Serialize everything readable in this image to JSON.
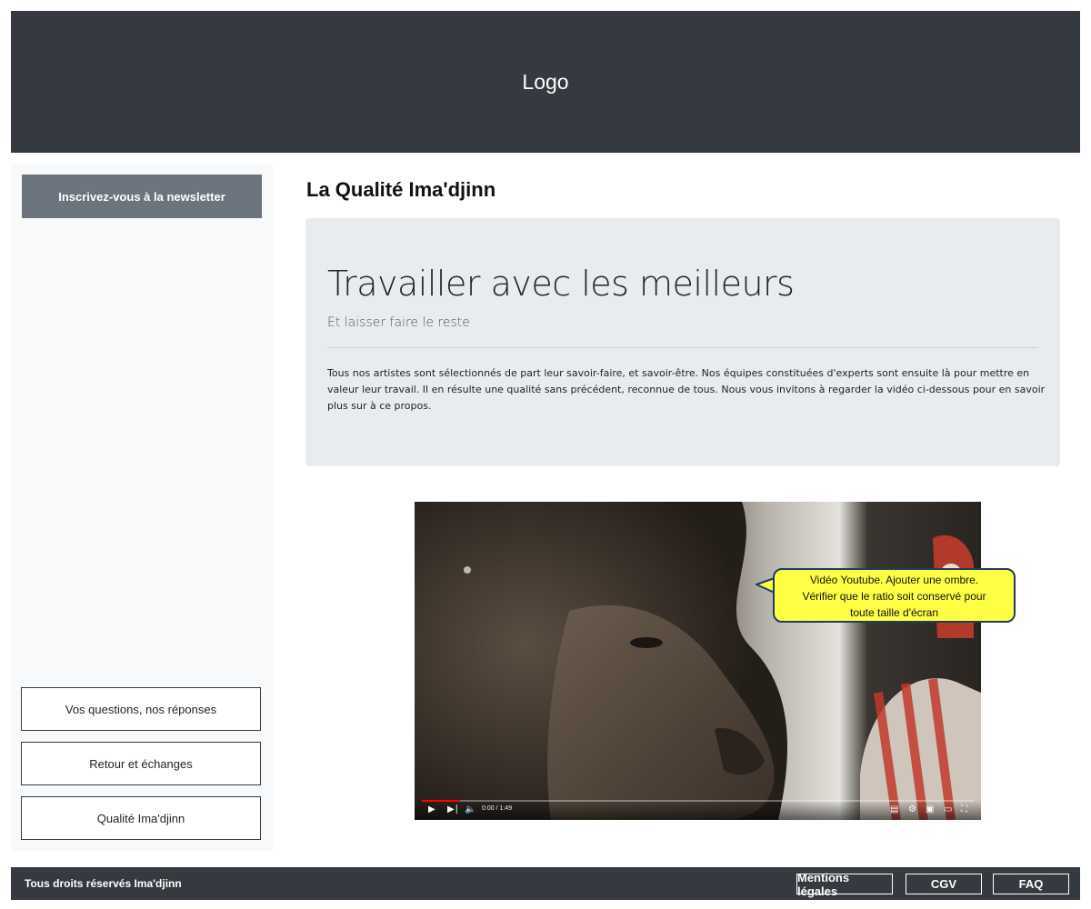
{
  "header": {
    "logo_text": "Logo"
  },
  "sidebar": {
    "newsletter_label": "Inscrivez-vous à la newsletter",
    "links": [
      {
        "label": "Vos questions, nos réponses"
      },
      {
        "label": "Retour et échanges"
      },
      {
        "label": "Qualité Ima'djinn"
      }
    ]
  },
  "main": {
    "title": "La Qualité Ima'djinn",
    "jumbotron": {
      "heading": "Travailler avec les meilleurs",
      "subheading": "Et laisser faire le reste",
      "text": "Tous nos artistes sont sélectionnés de part leur savoir-faire, et savoir-être. Nos équipes constituées d'experts sont ensuite là pour mettre en valeur leur travail. Il en résulte une qualité sans précédent, reconnue de tous. Nous vous invitons à regarder la vidéo ci-dessous pour en savoir plus sur à ce propos."
    },
    "video": {
      "time": "0:00 / 1:49",
      "progress": 0.07,
      "icons": [
        "play-icon",
        "next-icon",
        "volume-icon",
        "subtitles-icon",
        "settings-icon",
        "miniplayer-icon",
        "theater-icon",
        "fullscreen-icon"
      ]
    },
    "callout": {
      "line1": "Vidéo Youtube. Ajouter une ombre.",
      "line2": "Vérifier que le ratio soit conservé pour",
      "line3": "toute taille d'écran"
    }
  },
  "footer": {
    "copyright": "Tous droits réservés Ima'djinn",
    "links": [
      {
        "label": "Mentions légales"
      },
      {
        "label": "CGV"
      },
      {
        "label": "FAQ"
      }
    ]
  },
  "colors": {
    "dark": "#343a40",
    "light_bg": "#f8f9fa",
    "secondary": "#6c757d",
    "jumbotron_bg": "#e9ecef",
    "callout_bg": "#ffff44",
    "progress": "#ff0000"
  }
}
